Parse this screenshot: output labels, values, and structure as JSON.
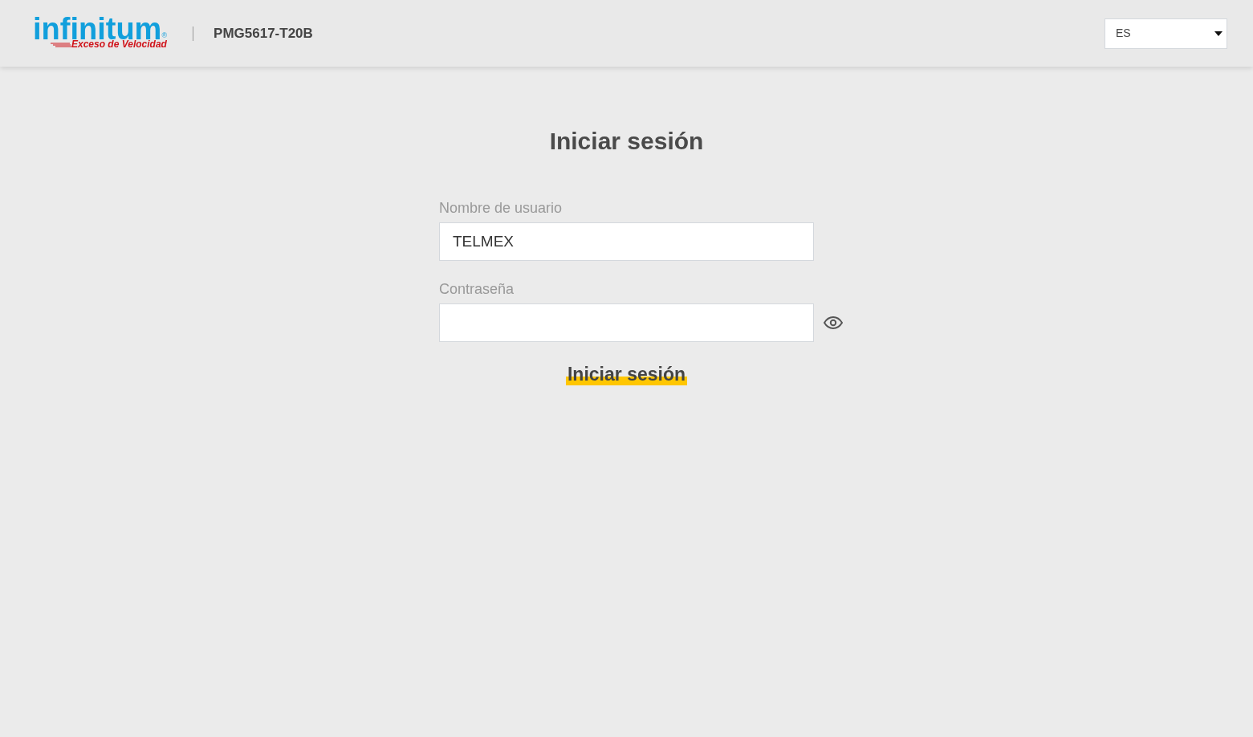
{
  "header": {
    "logo": {
      "wordmark": "infinitum",
      "registered": "®",
      "tagline": "Exceso de Velocidad"
    },
    "model": "PMG5617-T20B",
    "language": {
      "value": "ES"
    }
  },
  "login": {
    "title": "Iniciar sesión",
    "fields": [
      {
        "label": "Nombre de usuario",
        "value": "TELMEX",
        "kind": "text"
      },
      {
        "label": "Contraseña",
        "kind": "password"
      }
    ],
    "submit": "Iniciar sesión"
  }
}
